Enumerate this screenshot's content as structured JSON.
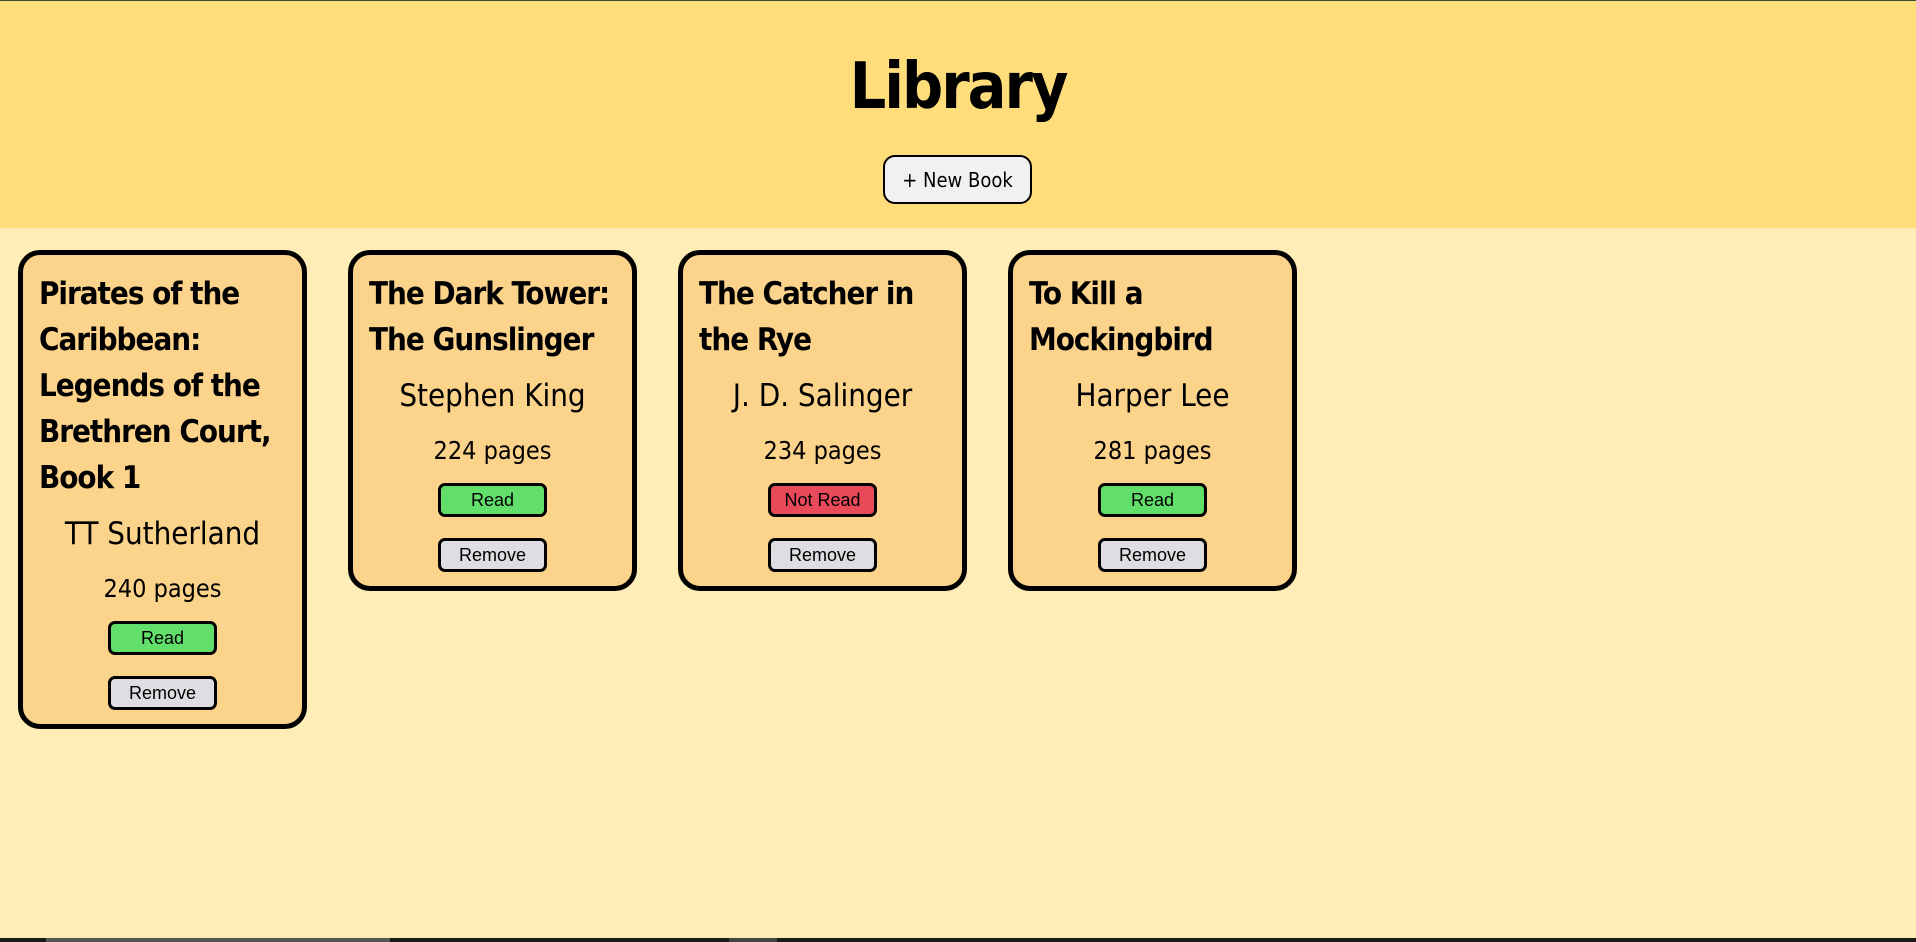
{
  "header": {
    "title": "Library",
    "new_book_label": "+ New Book"
  },
  "books": [
    {
      "title": "Pirates of the Caribbean: Legends of the Brethren Court, Book 1",
      "author": "TT Sutherland",
      "pages": "240 pages",
      "status": "Read",
      "remove_label": "Remove"
    },
    {
      "title": "The Dark Tower: The Gunslinger",
      "author": "Stephen King",
      "pages": "224 pages",
      "status": "Read",
      "remove_label": "Remove"
    },
    {
      "title": "The Catcher in the Rye",
      "author": "J. D. Salinger",
      "pages": "234 pages",
      "status": "Not Read",
      "remove_label": "Remove"
    },
    {
      "title": "To Kill a Mockingbird",
      "author": "Harper Lee",
      "pages": "281 pages",
      "status": "Read",
      "remove_label": "Remove"
    }
  ],
  "colors": {
    "header_bg": "#FFDD7A",
    "page_bg": "#FFEDB8",
    "card_bg": "#FCD38A",
    "read": "#62DE6A",
    "not_read": "#E84A5A",
    "remove": "#DEDEE2"
  }
}
